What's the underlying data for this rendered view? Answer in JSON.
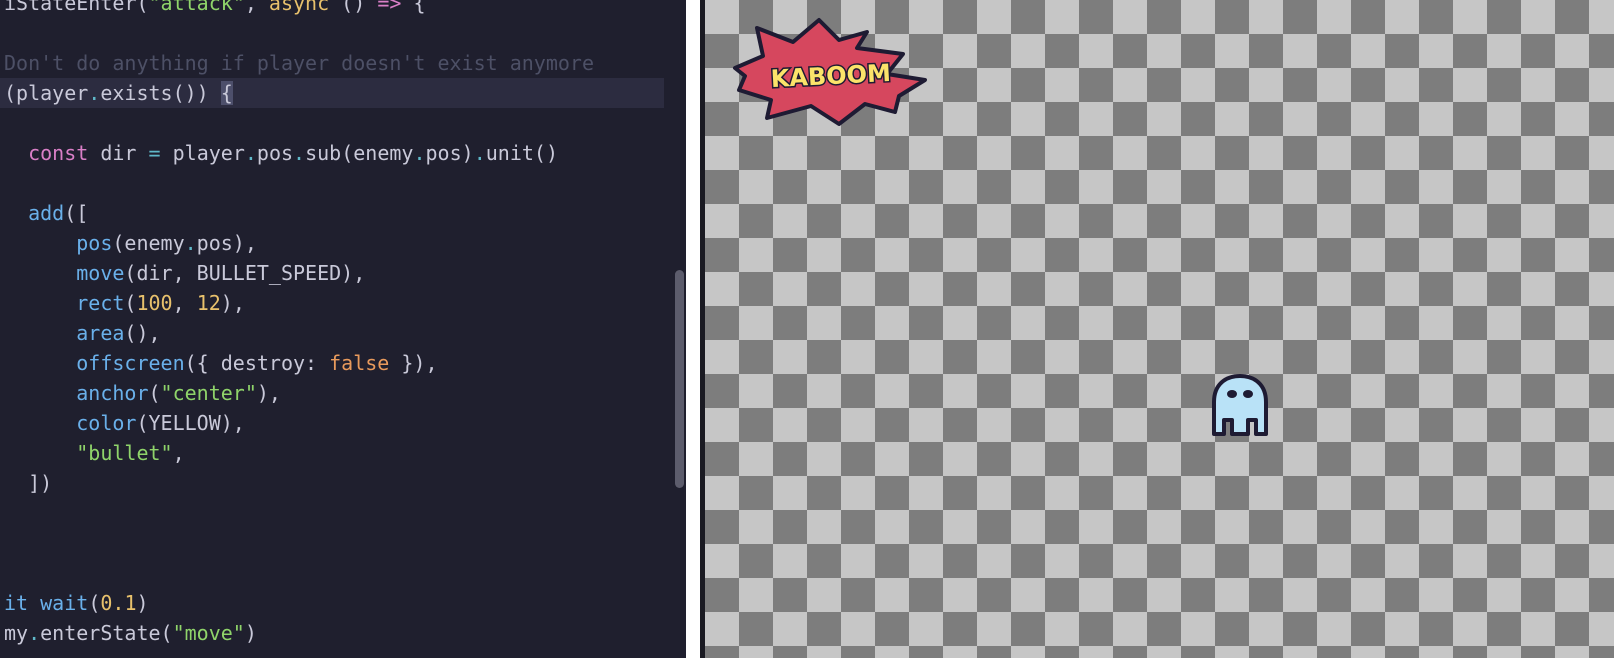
{
  "editor": {
    "lines": [
      {
        "tokens": [
          [
            "txt",
            "iStateEnter("
          ],
          [
            "str",
            "\"attack\""
          ],
          [
            "txt",
            ", "
          ],
          [
            "num",
            "async"
          ],
          [
            "txt",
            " () "
          ],
          [
            "kw",
            "=>"
          ],
          [
            "txt",
            " {"
          ]
        ]
      },
      {
        "tokens": []
      },
      {
        "tokens": [
          [
            "cmt",
            "Don't do anything if player doesn't exist anymore"
          ]
        ]
      },
      {
        "tokens": [
          [
            "txt",
            "(player"
          ],
          [
            "op",
            "."
          ],
          [
            "txt",
            "exists()) "
          ],
          [
            "brace",
            "{"
          ]
        ],
        "current": true
      },
      {
        "tokens": []
      },
      {
        "tokens": [
          [
            "txt",
            "  "
          ],
          [
            "kw",
            "const"
          ],
          [
            "txt",
            " dir "
          ],
          [
            "op",
            "="
          ],
          [
            "txt",
            " player"
          ],
          [
            "op",
            "."
          ],
          [
            "txt",
            "pos"
          ],
          [
            "op",
            "."
          ],
          [
            "txt",
            "sub(enemy"
          ],
          [
            "op",
            "."
          ],
          [
            "txt",
            "pos)"
          ],
          [
            "op",
            "."
          ],
          [
            "txt",
            "unit()"
          ]
        ]
      },
      {
        "tokens": []
      },
      {
        "tokens": [
          [
            "txt",
            "  "
          ],
          [
            "fn",
            "add"
          ],
          [
            "txt",
            "(["
          ]
        ]
      },
      {
        "tokens": [
          [
            "txt",
            "      "
          ],
          [
            "fn",
            "pos"
          ],
          [
            "txt",
            "(enemy"
          ],
          [
            "op",
            "."
          ],
          [
            "txt",
            "pos),"
          ]
        ]
      },
      {
        "tokens": [
          [
            "txt",
            "      "
          ],
          [
            "fn",
            "move"
          ],
          [
            "txt",
            "(dir, BULLET_SPEED),"
          ]
        ]
      },
      {
        "tokens": [
          [
            "txt",
            "      "
          ],
          [
            "fn",
            "rect"
          ],
          [
            "txt",
            "("
          ],
          [
            "num",
            "100"
          ],
          [
            "txt",
            ", "
          ],
          [
            "num",
            "12"
          ],
          [
            "txt",
            "),"
          ]
        ]
      },
      {
        "tokens": [
          [
            "txt",
            "      "
          ],
          [
            "fn",
            "area"
          ],
          [
            "txt",
            "(),"
          ]
        ]
      },
      {
        "tokens": [
          [
            "txt",
            "      "
          ],
          [
            "fn",
            "offscreen"
          ],
          [
            "txt",
            "({ destroy: "
          ],
          [
            "bool",
            "false"
          ],
          [
            "txt",
            " }),"
          ]
        ]
      },
      {
        "tokens": [
          [
            "txt",
            "      "
          ],
          [
            "fn",
            "anchor"
          ],
          [
            "txt",
            "("
          ],
          [
            "str",
            "\"center\""
          ],
          [
            "txt",
            "),"
          ]
        ]
      },
      {
        "tokens": [
          [
            "txt",
            "      "
          ],
          [
            "fn",
            "color"
          ],
          [
            "txt",
            "(YELLOW),"
          ]
        ]
      },
      {
        "tokens": [
          [
            "txt",
            "      "
          ],
          [
            "str",
            "\"bullet\""
          ],
          [
            "txt",
            ","
          ]
        ]
      },
      {
        "tokens": [
          [
            "txt",
            "  ])"
          ]
        ]
      },
      {
        "tokens": []
      },
      {
        "tokens": []
      },
      {
        "tokens": []
      },
      {
        "tokens": [
          [
            "fn",
            "it"
          ],
          [
            "txt",
            " "
          ],
          [
            "fn",
            "wait"
          ],
          [
            "txt",
            "("
          ],
          [
            "num",
            "0.1"
          ],
          [
            "txt",
            ")"
          ]
        ]
      },
      {
        "tokens": [
          [
            "txt",
            "my"
          ],
          [
            "op",
            "."
          ],
          [
            "txt",
            "enterState("
          ],
          [
            "str",
            "\"move\""
          ],
          [
            "txt",
            ")"
          ]
        ]
      }
    ]
  },
  "game": {
    "logo_text": "KABOOM",
    "colors": {
      "logo_fill": "#d6475e",
      "logo_text": "#fbe36a",
      "ghost_fill": "#b9e2f7",
      "outline": "#1e1b33"
    }
  }
}
